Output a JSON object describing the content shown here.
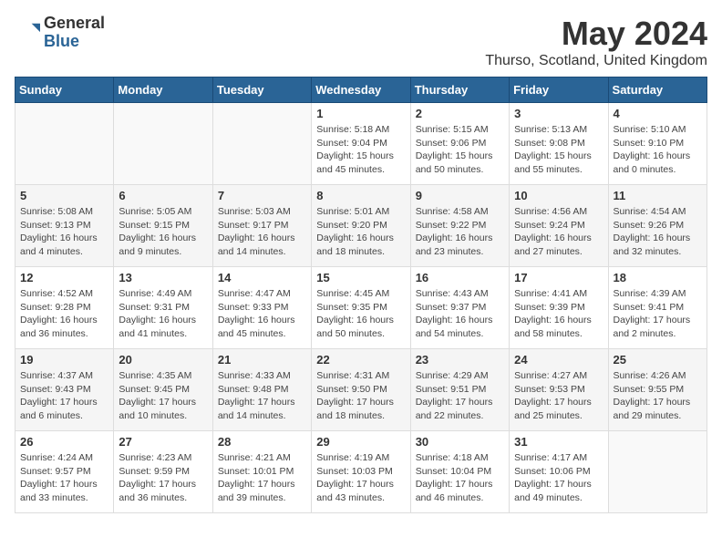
{
  "logo": {
    "general": "General",
    "blue": "Blue"
  },
  "title": "May 2024",
  "location": "Thurso, Scotland, United Kingdom",
  "days_header": [
    "Sunday",
    "Monday",
    "Tuesday",
    "Wednesday",
    "Thursday",
    "Friday",
    "Saturday"
  ],
  "weeks": [
    [
      {
        "day": "",
        "content": ""
      },
      {
        "day": "",
        "content": ""
      },
      {
        "day": "",
        "content": ""
      },
      {
        "day": "1",
        "content": "Sunrise: 5:18 AM\nSunset: 9:04 PM\nDaylight: 15 hours and 45 minutes."
      },
      {
        "day": "2",
        "content": "Sunrise: 5:15 AM\nSunset: 9:06 PM\nDaylight: 15 hours and 50 minutes."
      },
      {
        "day": "3",
        "content": "Sunrise: 5:13 AM\nSunset: 9:08 PM\nDaylight: 15 hours and 55 minutes."
      },
      {
        "day": "4",
        "content": "Sunrise: 5:10 AM\nSunset: 9:10 PM\nDaylight: 16 hours and 0 minutes."
      }
    ],
    [
      {
        "day": "5",
        "content": "Sunrise: 5:08 AM\nSunset: 9:13 PM\nDaylight: 16 hours and 4 minutes."
      },
      {
        "day": "6",
        "content": "Sunrise: 5:05 AM\nSunset: 9:15 PM\nDaylight: 16 hours and 9 minutes."
      },
      {
        "day": "7",
        "content": "Sunrise: 5:03 AM\nSunset: 9:17 PM\nDaylight: 16 hours and 14 minutes."
      },
      {
        "day": "8",
        "content": "Sunrise: 5:01 AM\nSunset: 9:20 PM\nDaylight: 16 hours and 18 minutes."
      },
      {
        "day": "9",
        "content": "Sunrise: 4:58 AM\nSunset: 9:22 PM\nDaylight: 16 hours and 23 minutes."
      },
      {
        "day": "10",
        "content": "Sunrise: 4:56 AM\nSunset: 9:24 PM\nDaylight: 16 hours and 27 minutes."
      },
      {
        "day": "11",
        "content": "Sunrise: 4:54 AM\nSunset: 9:26 PM\nDaylight: 16 hours and 32 minutes."
      }
    ],
    [
      {
        "day": "12",
        "content": "Sunrise: 4:52 AM\nSunset: 9:28 PM\nDaylight: 16 hours and 36 minutes."
      },
      {
        "day": "13",
        "content": "Sunrise: 4:49 AM\nSunset: 9:31 PM\nDaylight: 16 hours and 41 minutes."
      },
      {
        "day": "14",
        "content": "Sunrise: 4:47 AM\nSunset: 9:33 PM\nDaylight: 16 hours and 45 minutes."
      },
      {
        "day": "15",
        "content": "Sunrise: 4:45 AM\nSunset: 9:35 PM\nDaylight: 16 hours and 50 minutes."
      },
      {
        "day": "16",
        "content": "Sunrise: 4:43 AM\nSunset: 9:37 PM\nDaylight: 16 hours and 54 minutes."
      },
      {
        "day": "17",
        "content": "Sunrise: 4:41 AM\nSunset: 9:39 PM\nDaylight: 16 hours and 58 minutes."
      },
      {
        "day": "18",
        "content": "Sunrise: 4:39 AM\nSunset: 9:41 PM\nDaylight: 17 hours and 2 minutes."
      }
    ],
    [
      {
        "day": "19",
        "content": "Sunrise: 4:37 AM\nSunset: 9:43 PM\nDaylight: 17 hours and 6 minutes."
      },
      {
        "day": "20",
        "content": "Sunrise: 4:35 AM\nSunset: 9:45 PM\nDaylight: 17 hours and 10 minutes."
      },
      {
        "day": "21",
        "content": "Sunrise: 4:33 AM\nSunset: 9:48 PM\nDaylight: 17 hours and 14 minutes."
      },
      {
        "day": "22",
        "content": "Sunrise: 4:31 AM\nSunset: 9:50 PM\nDaylight: 17 hours and 18 minutes."
      },
      {
        "day": "23",
        "content": "Sunrise: 4:29 AM\nSunset: 9:51 PM\nDaylight: 17 hours and 22 minutes."
      },
      {
        "day": "24",
        "content": "Sunrise: 4:27 AM\nSunset: 9:53 PM\nDaylight: 17 hours and 25 minutes."
      },
      {
        "day": "25",
        "content": "Sunrise: 4:26 AM\nSunset: 9:55 PM\nDaylight: 17 hours and 29 minutes."
      }
    ],
    [
      {
        "day": "26",
        "content": "Sunrise: 4:24 AM\nSunset: 9:57 PM\nDaylight: 17 hours and 33 minutes."
      },
      {
        "day": "27",
        "content": "Sunrise: 4:23 AM\nSunset: 9:59 PM\nDaylight: 17 hours and 36 minutes."
      },
      {
        "day": "28",
        "content": "Sunrise: 4:21 AM\nSunset: 10:01 PM\nDaylight: 17 hours and 39 minutes."
      },
      {
        "day": "29",
        "content": "Sunrise: 4:19 AM\nSunset: 10:03 PM\nDaylight: 17 hours and 43 minutes."
      },
      {
        "day": "30",
        "content": "Sunrise: 4:18 AM\nSunset: 10:04 PM\nDaylight: 17 hours and 46 minutes."
      },
      {
        "day": "31",
        "content": "Sunrise: 4:17 AM\nSunset: 10:06 PM\nDaylight: 17 hours and 49 minutes."
      },
      {
        "day": "",
        "content": ""
      }
    ]
  ]
}
